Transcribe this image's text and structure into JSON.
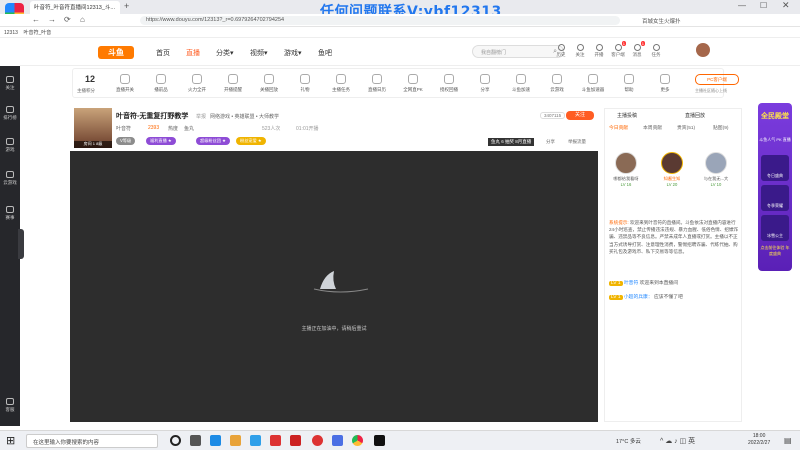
{
  "browser": {
    "tab_title": "叶音符_叶音符直播间12313_斗...",
    "url": "https://www.douyu.com/12313?_r=0.6979264702794254",
    "new_tab": "+",
    "nav": {
      "back": "←",
      "forward": "→",
      "reload": "⟳",
      "home": "⌂"
    },
    "search_hint": "百城女生火爆扑",
    "bookmarks": [
      "12313",
      "叶音符_叶音"
    ]
  },
  "watermark": "任何问题联系V:ybf12313",
  "sidebar": {
    "items": [
      {
        "label": "关注",
        "icon": "heart-icon"
      },
      {
        "label": "排行榜",
        "icon": "ranking-icon"
      },
      {
        "label": "游戏",
        "icon": "gamepad-icon"
      },
      {
        "label": "云游戏",
        "icon": "cloud-game-icon"
      },
      {
        "label": "赛事",
        "icon": "trophy-icon"
      },
      {
        "label": "客服",
        "icon": "headset-icon"
      }
    ]
  },
  "header": {
    "logo_text": "斗鱼",
    "nav": [
      {
        "label": "首页",
        "active": false
      },
      {
        "label": "直播",
        "active": true
      },
      {
        "label": "分类▾",
        "active": false
      },
      {
        "label": "视频▾",
        "active": false
      },
      {
        "label": "游戏▾",
        "active": false
      },
      {
        "label": "鱼吧",
        "active": false
      }
    ],
    "search_placeholder": "我自翻榜门",
    "icons": [
      {
        "label": "历史",
        "icon": "history-icon",
        "badge": ""
      },
      {
        "label": "关注",
        "icon": "follow-icon",
        "badge": ""
      },
      {
        "label": "开播",
        "icon": "broadcast-icon",
        "badge": ""
      },
      {
        "label": "客户端",
        "icon": "client-icon",
        "badge": "1"
      },
      {
        "label": "消息",
        "icon": "message-icon",
        "badge": "1"
      },
      {
        "label": "任务",
        "icon": "task-icon",
        "badge": ""
      }
    ]
  },
  "toolbar": {
    "level_number": "12",
    "level_label": "主播积分",
    "items": [
      {
        "label": "直播开关",
        "badge": "3"
      },
      {
        "label": "播前品"
      },
      {
        "label": "火力全开"
      },
      {
        "label": "开播提醒"
      },
      {
        "label": "关播回放"
      },
      {
        "label": "礼物"
      },
      {
        "label": "主播任务",
        "badge": "1"
      },
      {
        "label": "直播日历"
      },
      {
        "label": "全网直PK"
      },
      {
        "label": "授权回播"
      },
      {
        "label": "分享"
      },
      {
        "label": "斗鱼加速"
      },
      {
        "label": "云游戏"
      },
      {
        "label": "斗鱼加速器"
      },
      {
        "label": "帮助"
      },
      {
        "label": "更多"
      }
    ],
    "pc_client": "PC客户端",
    "pc_client_sub": "主播社区随心上线"
  },
  "streamer": {
    "title": "叶音符-无重复打野教学",
    "report": "举报",
    "category": "网络游戏 • 英雄联盟 • 大师教学",
    "name": "叶音符",
    "hot": "2393",
    "hot_label": "热度",
    "fans_label": "鱼丸",
    "avatar_level": "房间  1  8级",
    "tags": [
      {
        "text": "V等级",
        "color": "#8c8c8c"
      },
      {
        "text": "福利直播 ★",
        "color": "#8e4cd6"
      },
      {
        "text": "超级粉丝团 ★",
        "color": "#8e4cd6"
      },
      {
        "text": "粉丝宠爱 ★",
        "color": "#f0b400"
      }
    ],
    "stat_1": "523人次",
    "stat_2": "01:01开播",
    "anchor_badge": "叶音符",
    "subscribe": "关注",
    "follow_count": "3407115",
    "pill": "鱼丸 6 抽奖 8月直播",
    "share": "分享",
    "report_btn": "举报流量"
  },
  "video": {
    "loading_message": "主播正在加油中，请稍后重试"
  },
  "right_panel": {
    "tabs": [
      "主播投稿",
      "直播回放"
    ],
    "subtabs": [
      "今日贡献",
      "本周贡献",
      "贵宾(51)",
      "贴图(9)"
    ],
    "top_fans": [
      {
        "name": "哪都给我看呀",
        "badge": "LV 16",
        "color": "#8a6a55"
      },
      {
        "name": "知邂生知",
        "badge": "LV 20",
        "color": "#5a3a32"
      },
      {
        "name": "与在我无...大",
        "badge": "LV 10",
        "color": "#9aa5b8"
      }
    ],
    "system_message_label": "系统提示:",
    "system_message": "欢迎来到叶音符的直播间。斗鱼依法对直播内容进行24小时巡查，禁止传播违法违规、暴力血腥、低俗色情、招嫖诈骗、违禁品等不良信息。严禁未成年人直播或打赏。主播以不正当方式诱导打赏、注意理性消费，警惕招聘诈骗、代练代抽、购买礼包及游戏币、私下交易等等信息。",
    "chat": [
      {
        "badge": "LV 1",
        "name": "叶音符",
        "text": "欢迎来到本直播间"
      },
      {
        "badge": "LV 1",
        "name": "小超的兵康：",
        "text": "应该不懂了吧"
      }
    ]
  },
  "ad": {
    "title": "全民殿堂",
    "subtitle": "斗鱼人气 PK 直播",
    "rows": [
      "冬日盛典",
      "冬季荣耀",
      "冰雪公主"
    ],
    "footer": "点击前往体验 年度盛典"
  },
  "taskbar": {
    "search_placeholder": "在这里输入你要搜索的内容",
    "weather": "17°C 多云",
    "time": "18:00",
    "date": "2022/2/27",
    "icons": [
      {
        "name": "start-icon",
        "color": "#222"
      },
      {
        "name": "task-view-icon",
        "color": "#444"
      },
      {
        "name": "edge-icon",
        "color": "#1d8be5"
      },
      {
        "name": "store-icon",
        "color": "#e8a33a"
      },
      {
        "name": "mail-icon",
        "color": "#2f9fe9"
      },
      {
        "name": "game-icon",
        "color": "#d33"
      },
      {
        "name": "netease-icon",
        "color": "#c22"
      },
      {
        "name": "media-icon",
        "color": "#d33"
      },
      {
        "name": "browser-icon",
        "color": "#4b6fe4"
      },
      {
        "name": "chrome-icon",
        "color": "#e24"
      },
      {
        "name": "obs-icon",
        "color": "#333"
      },
      {
        "name": "capture-icon",
        "color": "#111"
      }
    ]
  }
}
